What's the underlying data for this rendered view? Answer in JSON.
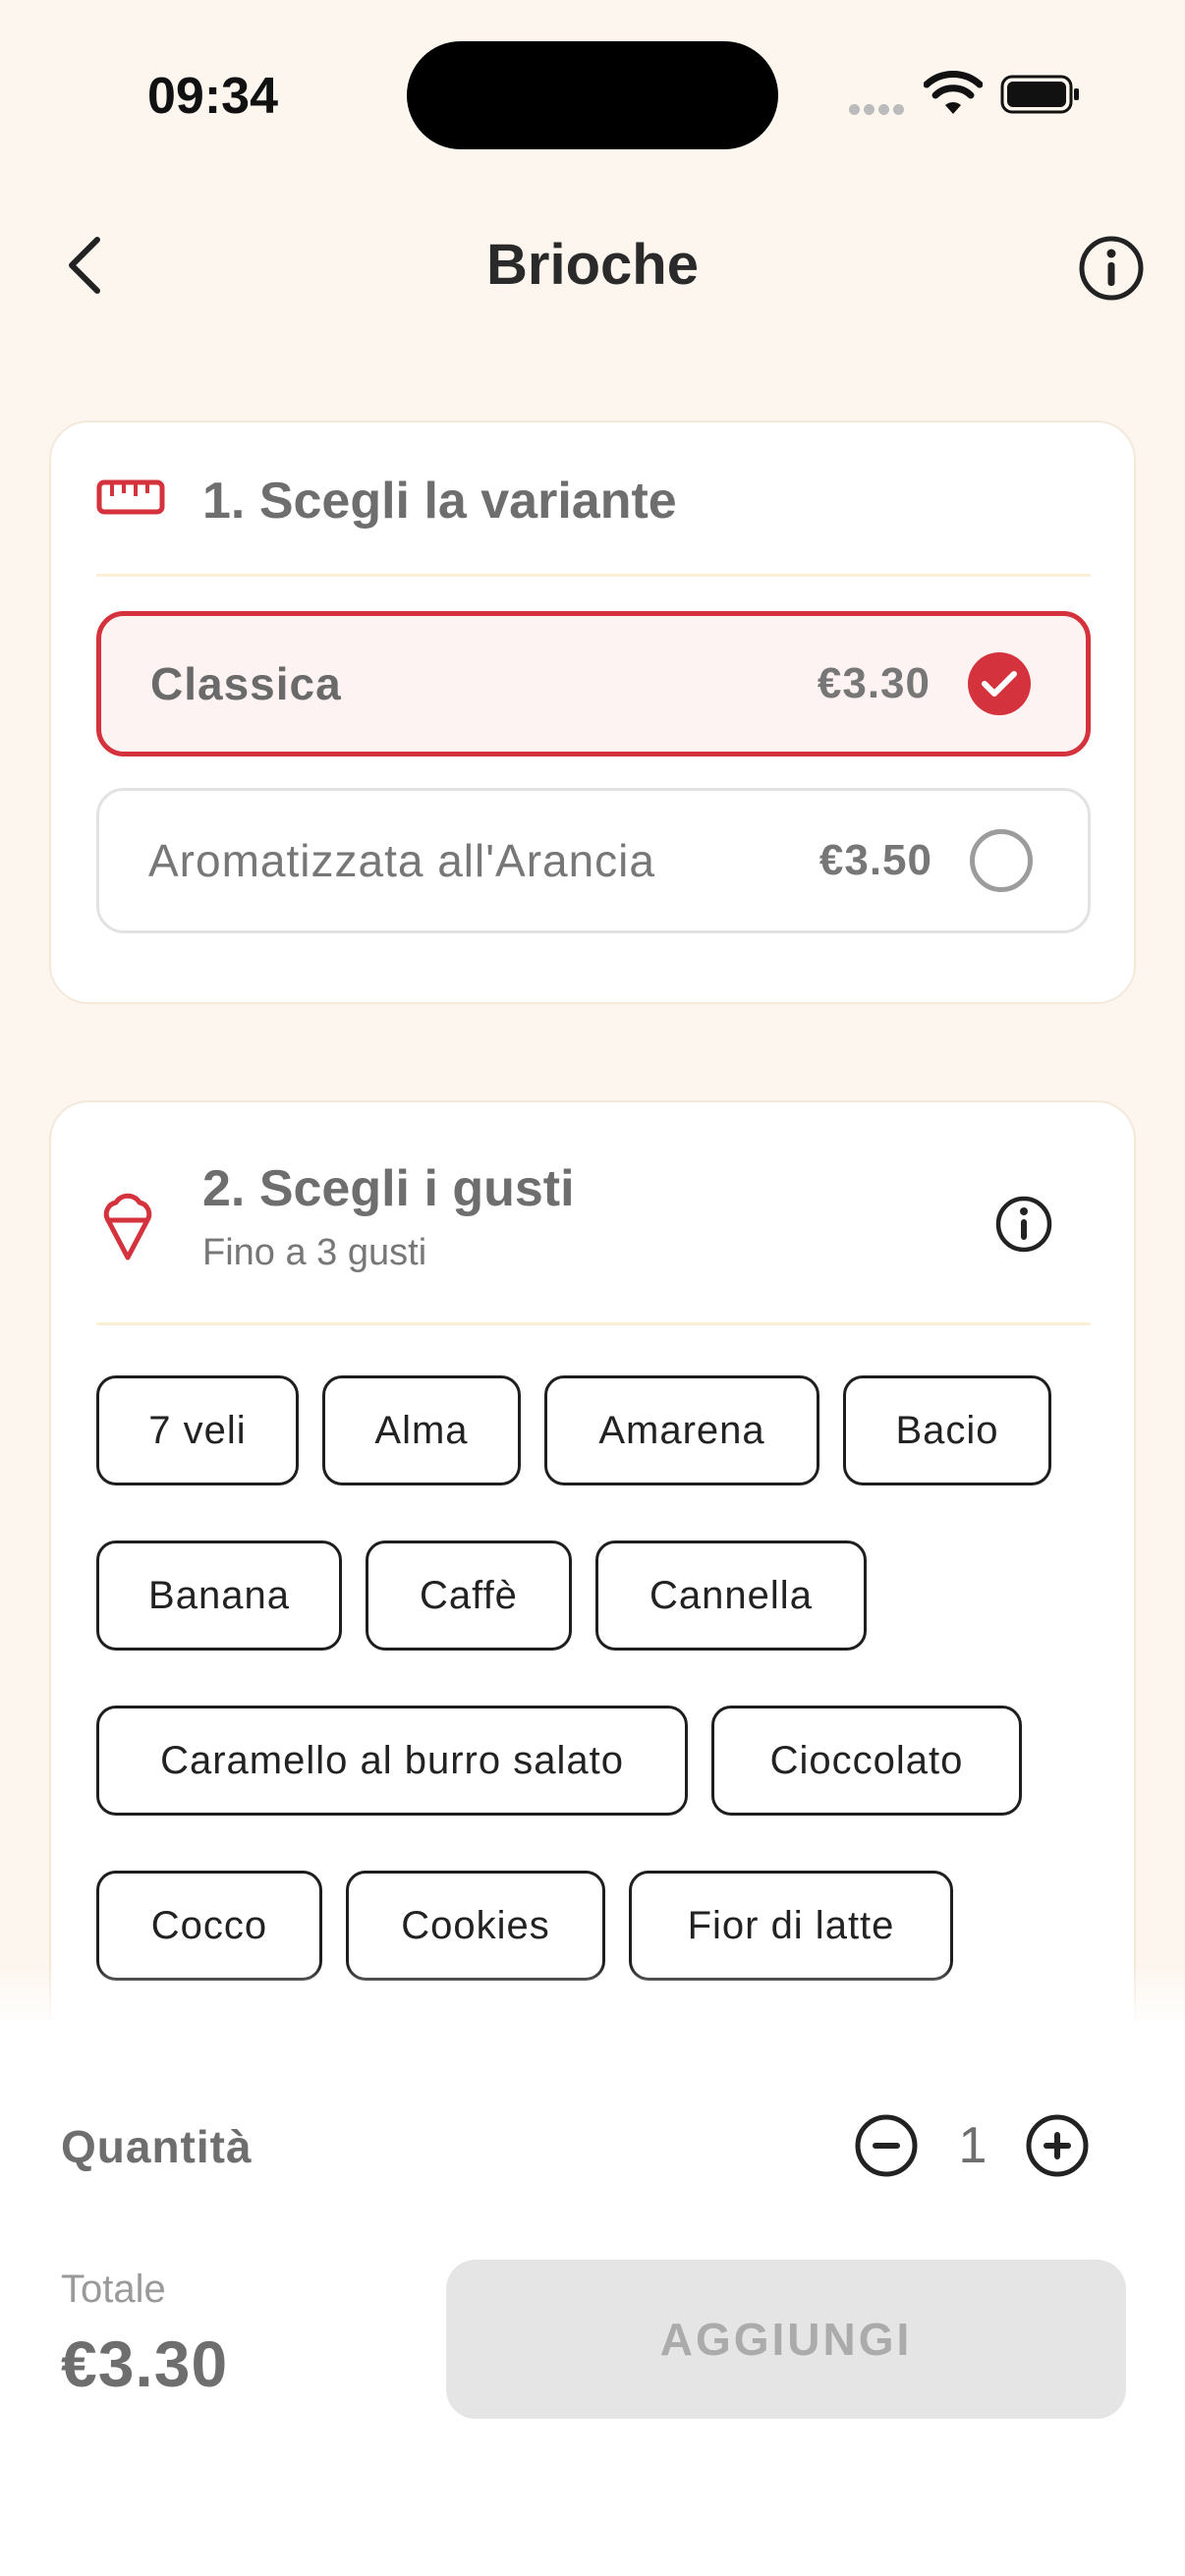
{
  "status_bar": {
    "time": "09:34"
  },
  "header": {
    "title": "Brioche"
  },
  "variant_section": {
    "title": "1. Scegli la variante",
    "options": [
      {
        "label": "Classica",
        "price": "€3.30",
        "selected": true
      },
      {
        "label": "Aromatizzata all'Arancia",
        "price": "€3.50",
        "selected": false
      }
    ]
  },
  "flavor_section": {
    "title": "2. Scegli i gusti",
    "subtitle": "Fino a 3 gusti",
    "flavors": [
      "7 veli",
      "Alma",
      "Amarena",
      "Bacio",
      "Banana",
      "Caffè",
      "Cannella",
      "Caramello al burro salato",
      "Cioccolato",
      "Cocco",
      "Cookies",
      "Fior di latte"
    ]
  },
  "bottom_panel": {
    "quantity_label": "Quantità",
    "quantity": "1",
    "total_label": "Totale",
    "total_value": "€3.30",
    "add_label": "AGGIUNGI"
  },
  "colors": {
    "accent": "#D4323C",
    "background": "#FDF6EF",
    "disabled_button": "#E5E5E5"
  },
  "icons": {
    "back": "chevron-left-icon",
    "info": "info-icon",
    "ruler": "ruler-icon",
    "ice_cream": "ice-cream-icon",
    "check": "check-icon",
    "minus": "minus-circle-icon",
    "plus": "plus-circle-icon"
  }
}
